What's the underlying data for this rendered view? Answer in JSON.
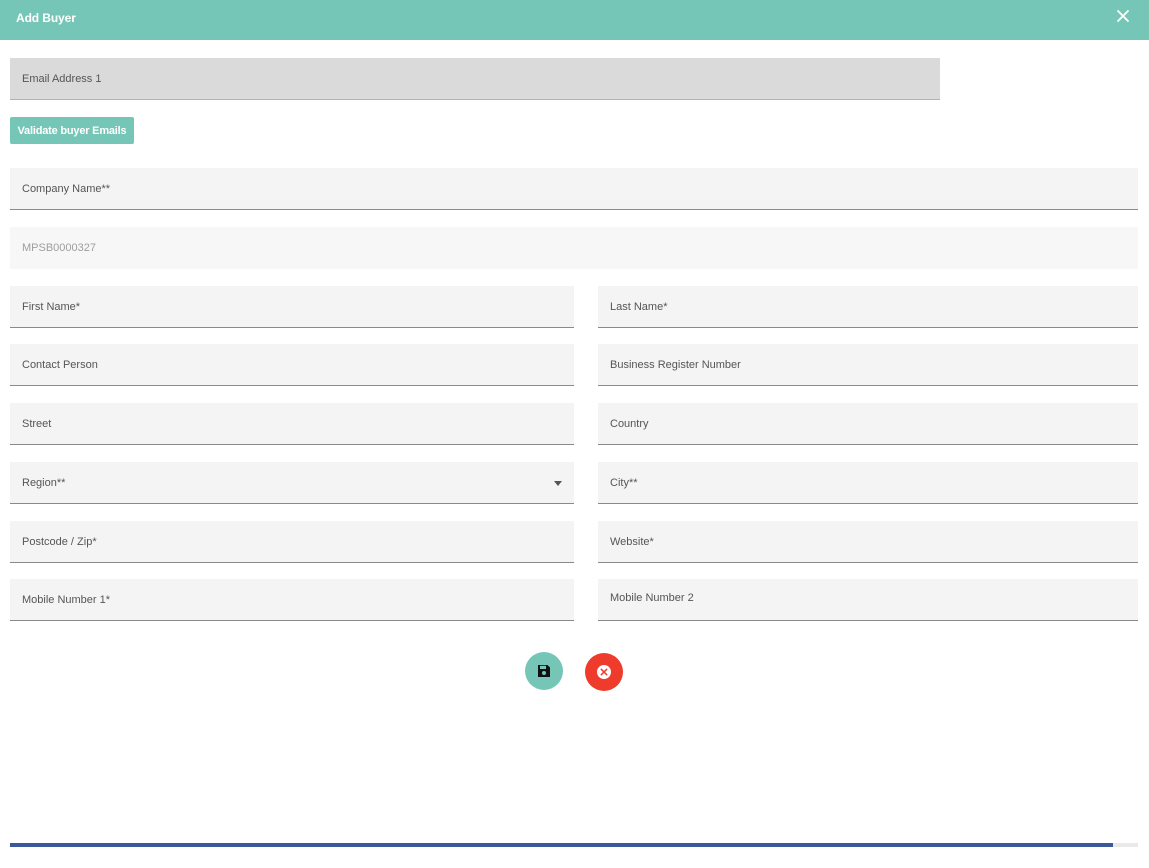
{
  "dialog": {
    "title": "Add Buyer"
  },
  "form": {
    "email_1": "Email Address 1",
    "validate_button": "Validate buyer Emails",
    "company_name": "Company Name**",
    "buyer_code": "MPSB0000327",
    "first_name": "First Name*",
    "last_name": "Last Name*",
    "contact_person": "Contact Person",
    "business_register_number": "Business Register Number",
    "street": "Street",
    "country": "Country",
    "region": "Region**",
    "city": "City**",
    "postcode": "Postcode / Zip*",
    "website": "Website*",
    "mobile_1": "Mobile Number 1*",
    "mobile_2": "Mobile Number 2"
  },
  "progress": {
    "fraction": 0.978
  },
  "icons": {
    "close": "close-icon",
    "save": "floppy-disk-icon",
    "cancel": "circle-x-icon",
    "region_dropdown": "caret-down-icon"
  },
  "colors": {
    "header": "#75c6b6",
    "save_button": "#75c6b6",
    "cancel_button": "#ef3b2c",
    "email_focus_underline": "#f2b01e",
    "progress_bar": "#3b5998"
  }
}
